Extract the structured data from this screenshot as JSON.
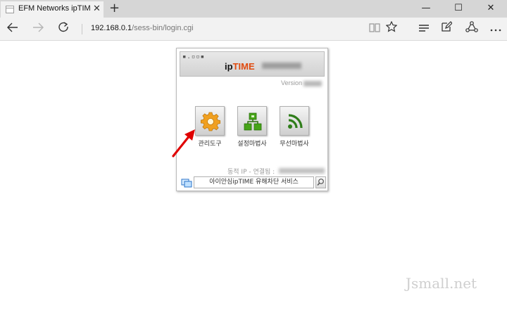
{
  "browser": {
    "tab_title": "EFM Networks ipTIME A",
    "tab_close": "✕",
    "new_tab": "+",
    "url_host": "192.168.0.1",
    "url_path": "/sess-bin/login.cgi",
    "window_controls": {
      "minimize": "—",
      "maximize": "☐",
      "close": "✕"
    }
  },
  "router": {
    "logo_prefix": "ip",
    "logo_suffix": "TIME",
    "brand_dots": "▪.▫▫▪",
    "version_label": "Version",
    "menus": [
      {
        "label": "관리도구",
        "icon": "gear-icon"
      },
      {
        "label": "설정마법사",
        "icon": "setup-wizard-icon"
      },
      {
        "label": "무선마법사",
        "icon": "wireless-icon"
      }
    ],
    "status_text": "동적 IP - 연결됨 :",
    "search_text": "아이안심ipTIME 유해차단 서비스"
  },
  "watermark": "Jsmall.net",
  "colors": {
    "accent_orange": "#e04b10",
    "gear": "#f0a020",
    "wizard_green": "#46a418",
    "wifi_green": "#2f7d1a",
    "arrow_red": "#e00000"
  }
}
